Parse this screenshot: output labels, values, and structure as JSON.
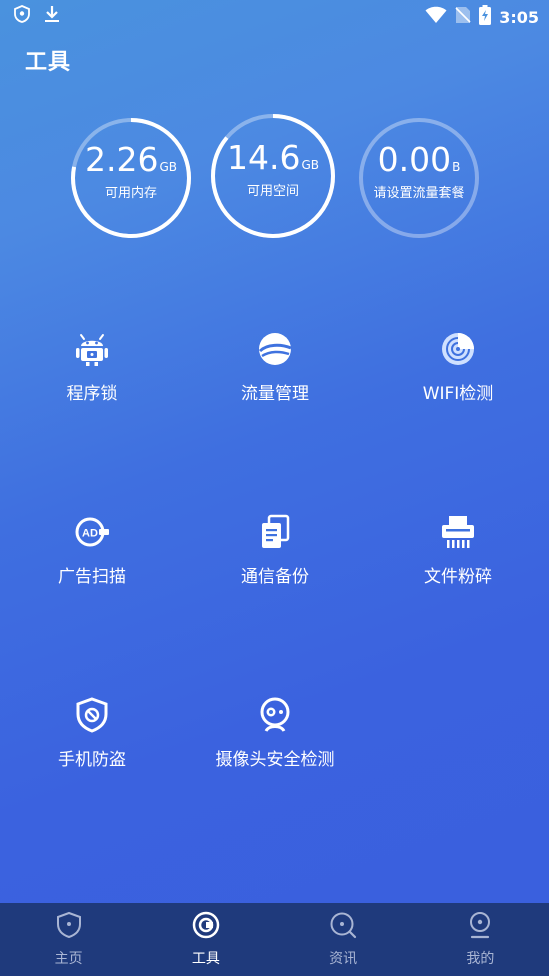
{
  "status_bar": {
    "time": "3:05"
  },
  "header": {
    "title": "工具"
  },
  "gauges": [
    {
      "value": "2.26",
      "unit": "GB",
      "label": "可用内存",
      "fraction": 0.78
    },
    {
      "value": "14.6",
      "unit": "GB",
      "label": "可用空间",
      "fraction": 0.86
    },
    {
      "value": "0.00",
      "unit": "B",
      "label": "请设置流量套餐",
      "fraction": 0.0
    }
  ],
  "tools": [
    {
      "label": "程序锁",
      "icon": "robot-lock-icon"
    },
    {
      "label": "流量管理",
      "icon": "planet-icon"
    },
    {
      "label": "WIFI检测",
      "icon": "radar-icon"
    },
    {
      "label": "广告扫描",
      "icon": "ad-scan-icon"
    },
    {
      "label": "通信备份",
      "icon": "documents-icon"
    },
    {
      "label": "文件粉碎",
      "icon": "shredder-icon"
    },
    {
      "label": "手机防盗",
      "icon": "shield-icon"
    },
    {
      "label": "摄像头安全检测",
      "icon": "webcam-icon"
    }
  ],
  "nav": [
    {
      "label": "主页",
      "icon": "shield-icon",
      "active": false
    },
    {
      "label": "工具",
      "icon": "tools-icon",
      "active": true
    },
    {
      "label": "资讯",
      "icon": "news-search-icon",
      "active": false
    },
    {
      "label": "我的",
      "icon": "profile-icon",
      "active": false
    }
  ]
}
